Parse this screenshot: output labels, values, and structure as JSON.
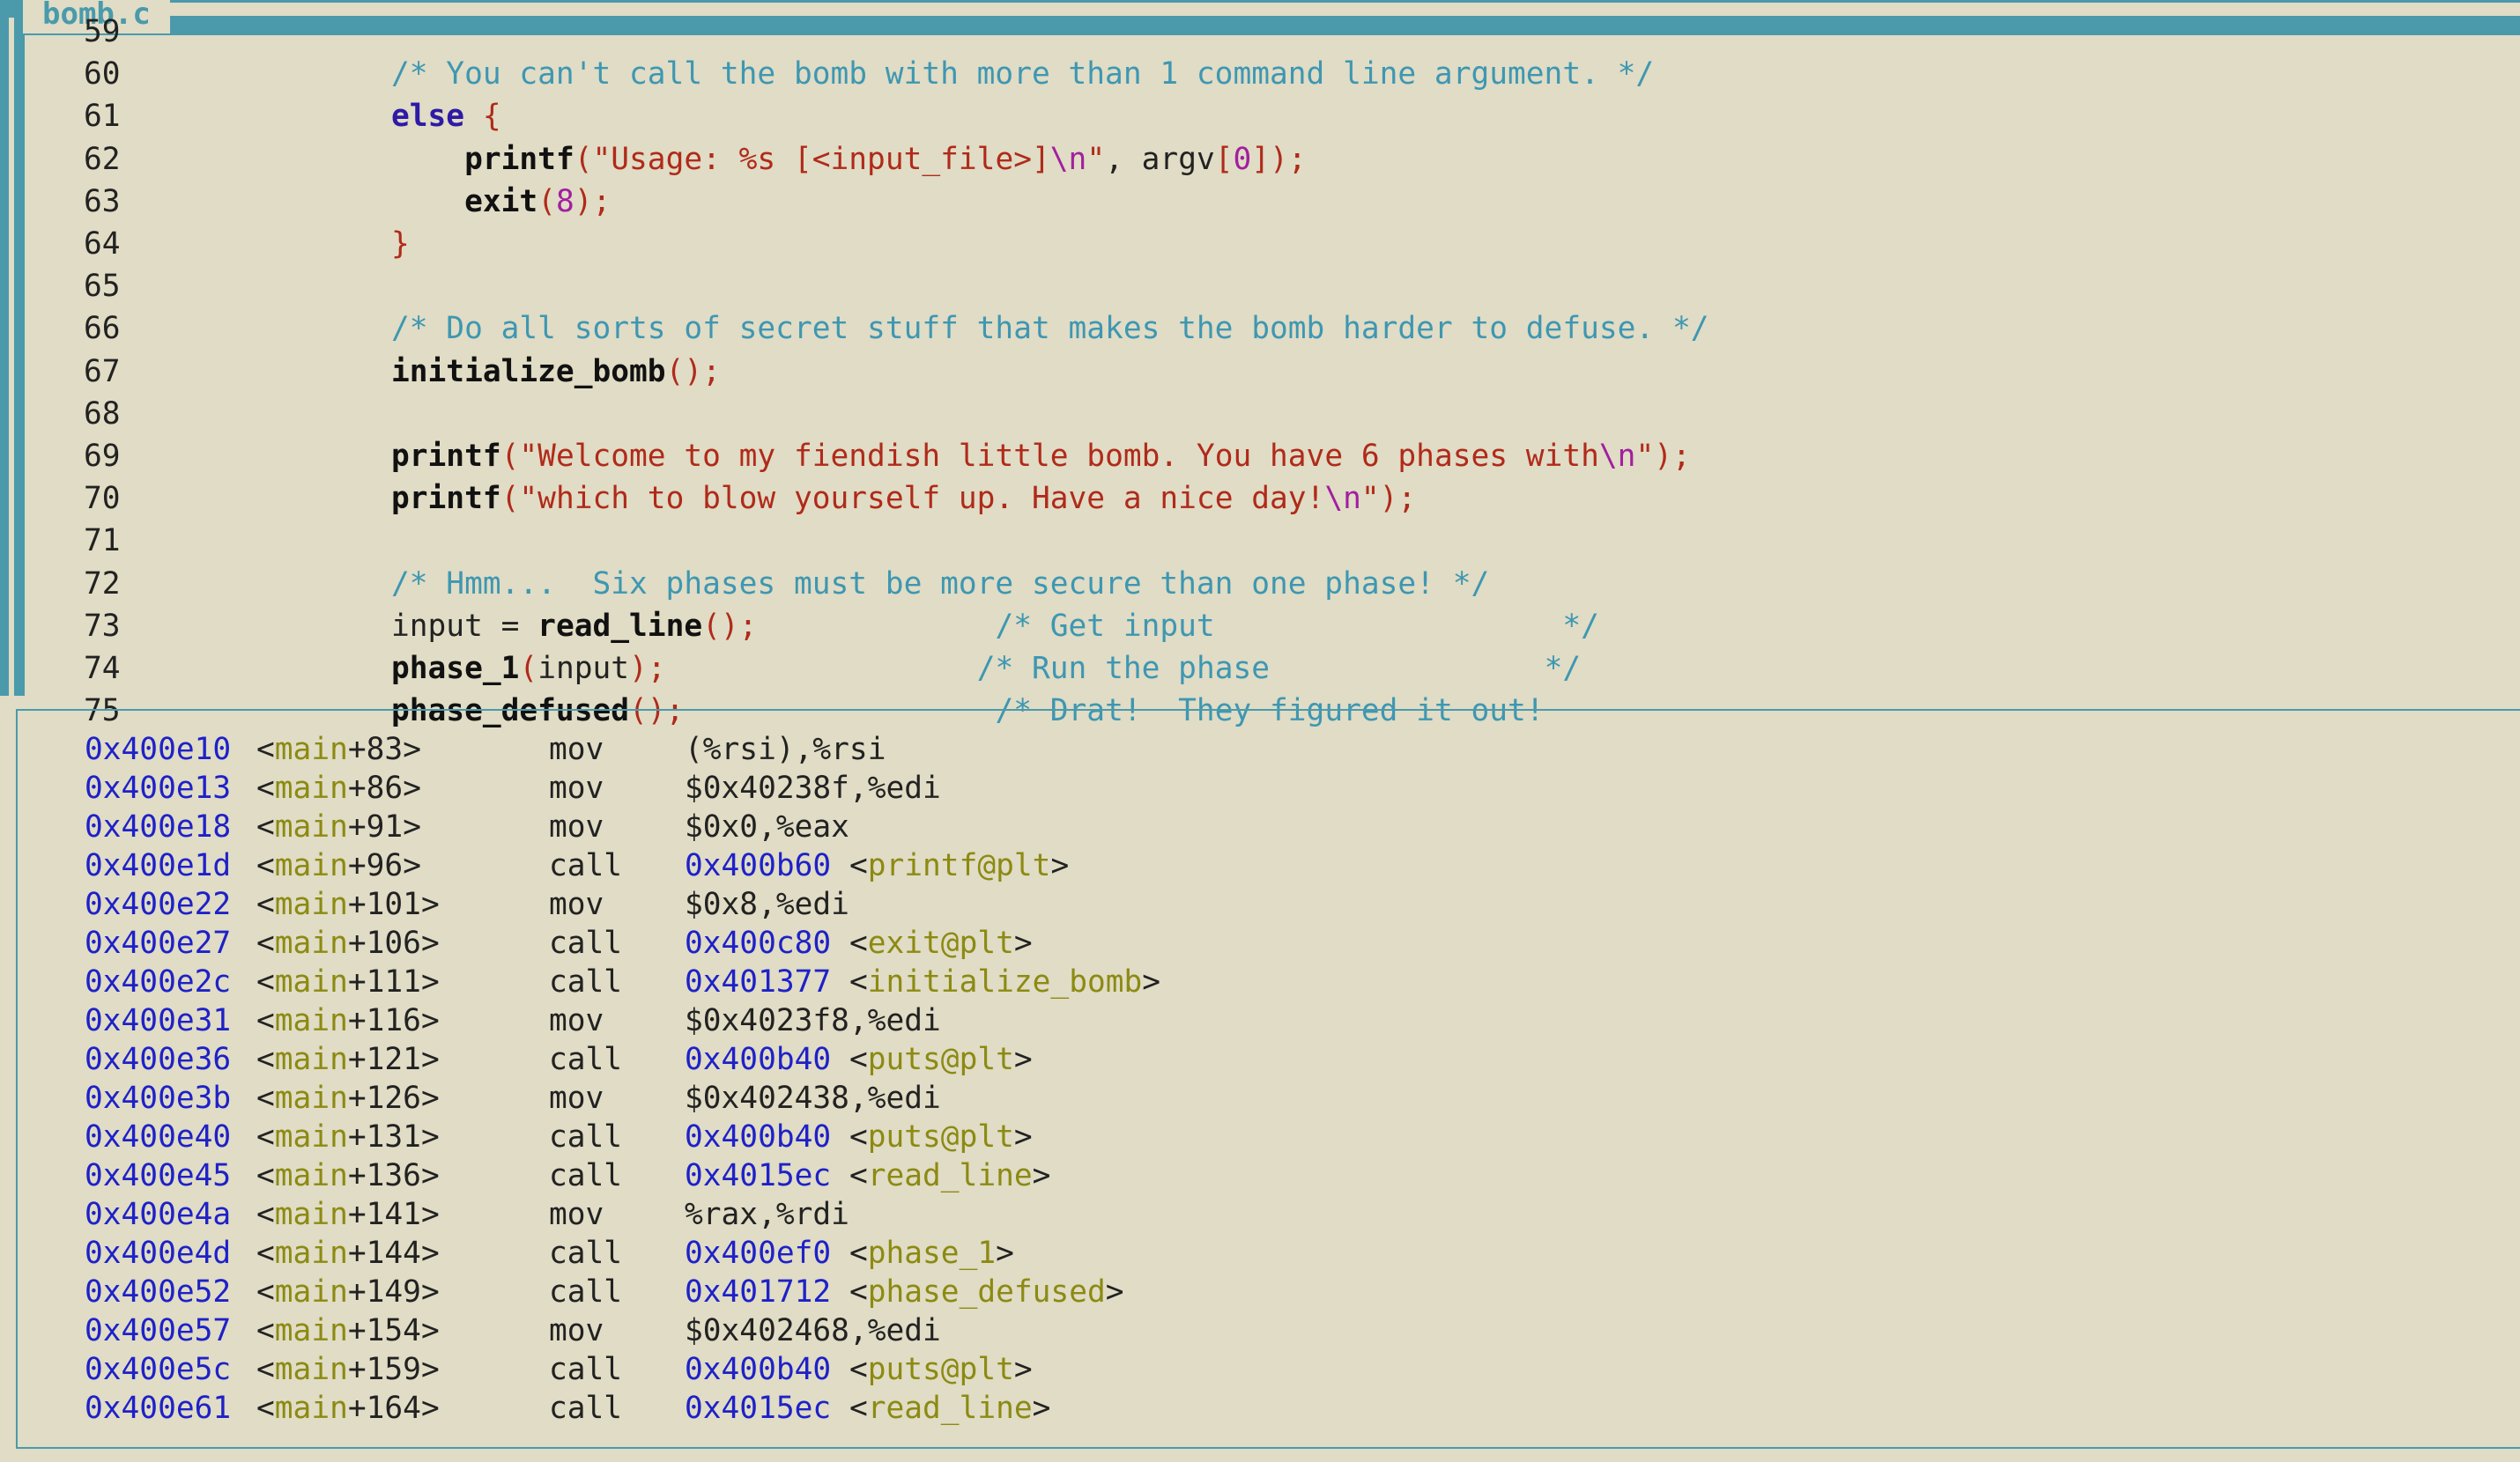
{
  "source_pane": {
    "title": "bomb.c",
    "lines": [
      {
        "no": "59",
        "segs": []
      },
      {
        "no": "60",
        "segs": [
          [
            "cmt",
            "/* You can't call the bomb with more than 1 command line argument. */"
          ]
        ]
      },
      {
        "no": "61",
        "segs": [
          [
            "kw",
            "else"
          ],
          [
            "id",
            " "
          ],
          [
            "pn",
            "{"
          ]
        ]
      },
      {
        "no": "62",
        "segs": [
          [
            "id",
            "    "
          ],
          [
            "fn",
            "printf"
          ],
          [
            "pn",
            "("
          ],
          [
            "str",
            "\"Usage: %s [<input_file>]"
          ],
          [
            "esc",
            "\\n"
          ],
          [
            "str",
            "\""
          ],
          [
            "id",
            ", argv"
          ],
          [
            "pn",
            "["
          ],
          [
            "num",
            "0"
          ],
          [
            "pn",
            "]);"
          ]
        ]
      },
      {
        "no": "63",
        "segs": [
          [
            "id",
            "    "
          ],
          [
            "fn",
            "exit"
          ],
          [
            "pn",
            "("
          ],
          [
            "num",
            "8"
          ],
          [
            "pn",
            ");"
          ]
        ]
      },
      {
        "no": "64",
        "segs": [
          [
            "pn",
            "}"
          ]
        ]
      },
      {
        "no": "65",
        "segs": []
      },
      {
        "no": "66",
        "segs": [
          [
            "cmt",
            "/* Do all sorts of secret stuff that makes the bomb harder to defuse. */"
          ]
        ]
      },
      {
        "no": "67",
        "segs": [
          [
            "fn",
            "initialize_bomb"
          ],
          [
            "pn",
            "();"
          ]
        ]
      },
      {
        "no": "68",
        "segs": []
      },
      {
        "no": "69",
        "segs": [
          [
            "fn",
            "printf"
          ],
          [
            "pn",
            "("
          ],
          [
            "str",
            "\"Welcome to my fiendish little bomb. You have 6 phases with"
          ],
          [
            "esc",
            "\\n"
          ],
          [
            "str",
            "\""
          ],
          [
            "pn",
            ");"
          ]
        ]
      },
      {
        "no": "70",
        "segs": [
          [
            "fn",
            "printf"
          ],
          [
            "pn",
            "("
          ],
          [
            "str",
            "\"which to blow yourself up. Have a nice day!"
          ],
          [
            "esc",
            "\\n"
          ],
          [
            "str",
            "\""
          ],
          [
            "pn",
            ");"
          ]
        ]
      },
      {
        "no": "71",
        "segs": []
      },
      {
        "no": "72",
        "segs": [
          [
            "cmt",
            "/* Hmm...  Six phases must be more secure than one phase! */"
          ]
        ]
      },
      {
        "no": "73",
        "segs": [
          [
            "id",
            "input = "
          ],
          [
            "fn",
            "read_line"
          ],
          [
            "pn",
            "();"
          ],
          [
            "id",
            "             "
          ],
          [
            "cmt",
            "/* Get input                   */"
          ]
        ]
      },
      {
        "no": "74",
        "segs": [
          [
            "fn",
            "phase_1"
          ],
          [
            "pn",
            "("
          ],
          [
            "id",
            "input"
          ],
          [
            "pn",
            ");"
          ],
          [
            "id",
            "                 "
          ],
          [
            "cmt",
            "/* Run the phase               */"
          ]
        ]
      },
      {
        "no": "75",
        "segs": [
          [
            "fn",
            "phase_defused"
          ],
          [
            "pn",
            "();"
          ],
          [
            "id",
            "                 "
          ],
          [
            "cmt",
            "/* Drat!  They figured it out!"
          ]
        ]
      }
    ]
  },
  "asm_pane": {
    "rows": [
      {
        "addr": "0x400e10",
        "fn": "main",
        "off": "+83",
        "op": "mov",
        "args": "(%rsi),%rsi",
        "target": "",
        "tsym": ""
      },
      {
        "addr": "0x400e13",
        "fn": "main",
        "off": "+86",
        "op": "mov",
        "args": "$0x40238f,%edi",
        "target": "",
        "tsym": ""
      },
      {
        "addr": "0x400e18",
        "fn": "main",
        "off": "+91",
        "op": "mov",
        "args": "$0x0,%eax",
        "target": "",
        "tsym": ""
      },
      {
        "addr": "0x400e1d",
        "fn": "main",
        "off": "+96",
        "op": "call",
        "args": "",
        "target": "0x400b60",
        "tsym": "printf@plt"
      },
      {
        "addr": "0x400e22",
        "fn": "main",
        "off": "+101",
        "op": "mov",
        "args": "$0x8,%edi",
        "target": "",
        "tsym": ""
      },
      {
        "addr": "0x400e27",
        "fn": "main",
        "off": "+106",
        "op": "call",
        "args": "",
        "target": "0x400c80",
        "tsym": "exit@plt"
      },
      {
        "addr": "0x400e2c",
        "fn": "main",
        "off": "+111",
        "op": "call",
        "args": "",
        "target": "0x401377",
        "tsym": "initialize_bomb"
      },
      {
        "addr": "0x400e31",
        "fn": "main",
        "off": "+116",
        "op": "mov",
        "args": "$0x4023f8,%edi",
        "target": "",
        "tsym": ""
      },
      {
        "addr": "0x400e36",
        "fn": "main",
        "off": "+121",
        "op": "call",
        "args": "",
        "target": "0x400b40",
        "tsym": "puts@plt"
      },
      {
        "addr": "0x400e3b",
        "fn": "main",
        "off": "+126",
        "op": "mov",
        "args": "$0x402438,%edi",
        "target": "",
        "tsym": ""
      },
      {
        "addr": "0x400e40",
        "fn": "main",
        "off": "+131",
        "op": "call",
        "args": "",
        "target": "0x400b40",
        "tsym": "puts@plt"
      },
      {
        "addr": "0x400e45",
        "fn": "main",
        "off": "+136",
        "op": "call",
        "args": "",
        "target": "0x4015ec",
        "tsym": "read_line"
      },
      {
        "addr": "0x400e4a",
        "fn": "main",
        "off": "+141",
        "op": "mov",
        "args": "%rax,%rdi",
        "target": "",
        "tsym": ""
      },
      {
        "addr": "0x400e4d",
        "fn": "main",
        "off": "+144",
        "op": "call",
        "args": "",
        "target": "0x400ef0",
        "tsym": "phase_1"
      },
      {
        "addr": "0x400e52",
        "fn": "main",
        "off": "+149",
        "op": "call",
        "args": "",
        "target": "0x401712",
        "tsym": "phase_defused"
      },
      {
        "addr": "0x400e57",
        "fn": "main",
        "off": "+154",
        "op": "mov",
        "args": "$0x402468,%edi",
        "target": "",
        "tsym": ""
      },
      {
        "addr": "0x400e5c",
        "fn": "main",
        "off": "+159",
        "op": "call",
        "args": "",
        "target": "0x400b40",
        "tsym": "puts@plt"
      },
      {
        "addr": "0x400e61",
        "fn": "main",
        "off": "+164",
        "op": "call",
        "args": "",
        "target": "0x4015ec",
        "tsym": "read_line"
      }
    ]
  }
}
